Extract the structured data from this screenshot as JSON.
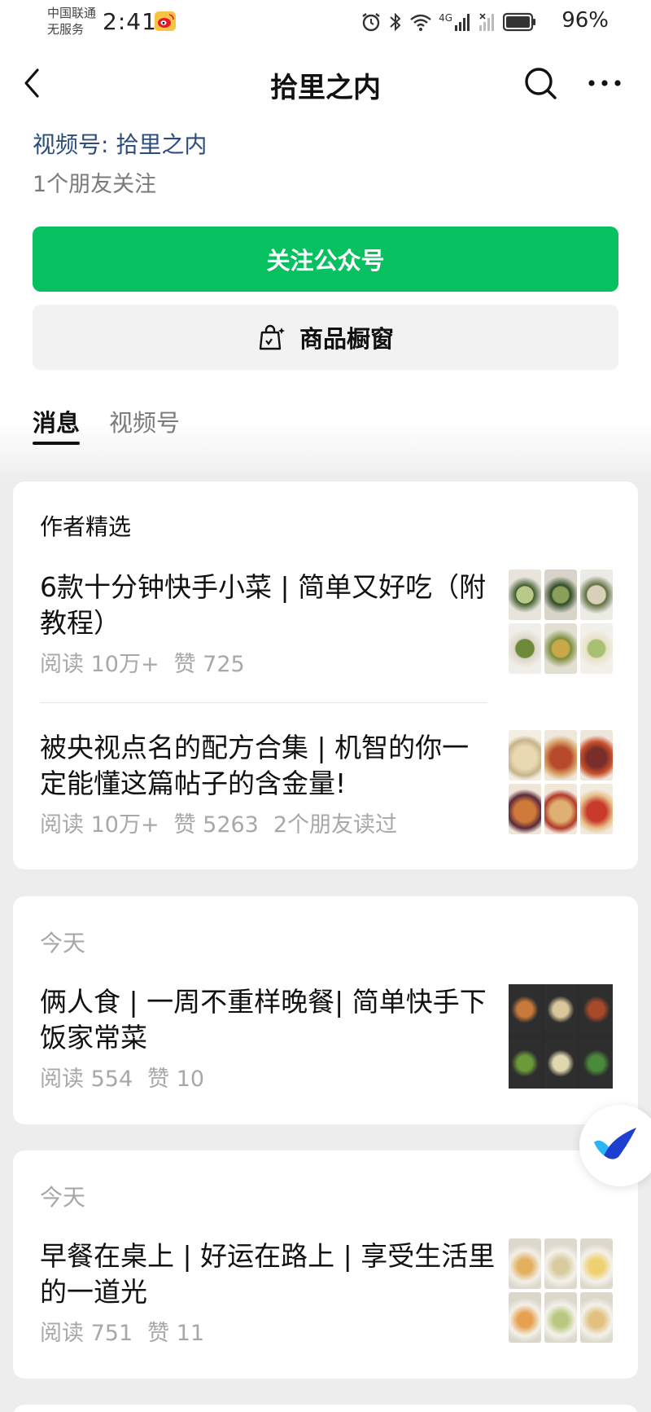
{
  "status_bar": {
    "carrier_line1": "中国联通",
    "carrier_line2": "无服务",
    "time": "2:41",
    "network_label": "4G",
    "battery": "96%"
  },
  "nav": {
    "title": "拾里之内",
    "back_icon": "chevron-left-icon",
    "search_icon": "search-icon",
    "more_icon": "more-dots-icon"
  },
  "account": {
    "channel_prefix": "视频号: ",
    "channel_name": "拾里之内",
    "friends_following": "1个朋友关注"
  },
  "buttons": {
    "follow": "关注公众号",
    "shop": "商品橱窗"
  },
  "tabs": [
    {
      "label": "消息",
      "active": true
    },
    {
      "label": "视频号",
      "active": false
    }
  ],
  "featured": {
    "heading": "作者精选",
    "articles": [
      {
        "title": "6款十分钟快手小菜 | 简单又好吃（附教程）",
        "reads": "阅读 10万+",
        "likes": "赞 725",
        "extra": ""
      },
      {
        "title": "被央视点名的配方合集 | 机智的你一定能懂这篇帖子的含金量!",
        "reads": "阅读 10万+",
        "likes": "赞 5263",
        "extra": "2个朋友读过"
      }
    ]
  },
  "feed": [
    {
      "date": "今天",
      "title": "俩人食 | 一周不重样晚餐| 简单快手下饭家常菜",
      "reads": "阅读 554",
      "likes": "赞 10"
    },
    {
      "date": "今天",
      "title": "早餐在桌上 | 好运在路上 | 享受生活里的一道光",
      "reads": "阅读 751",
      "likes": "赞 11"
    }
  ],
  "colors": {
    "accent_green": "#07c160",
    "link_blue": "#2b4d7e",
    "meta_gray": "#a8a8a8",
    "page_bg": "#ededed"
  }
}
